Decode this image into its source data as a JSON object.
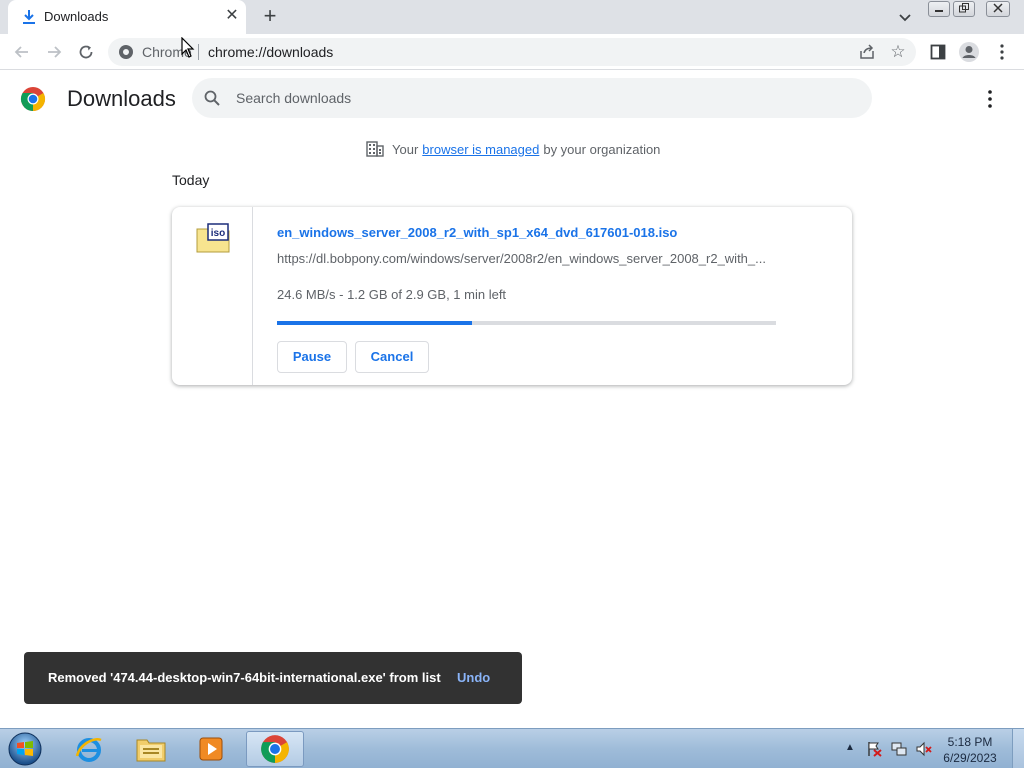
{
  "browser": {
    "tab": {
      "title": "Downloads",
      "icon": "download-icon",
      "close_icon": "close-icon"
    },
    "new_tab_icon": "plus-icon",
    "tab_search_icon": "chevron-down-icon",
    "window_controls": [
      "minimize",
      "restore",
      "close"
    ],
    "toolbar": {
      "back_icon": "back-arrow-icon",
      "forward_icon": "forward-arrow-icon",
      "reload_icon": "reload-icon",
      "omnibox": {
        "site_label": "Chrome",
        "url": "chrome://downloads"
      },
      "share_icon": "share-icon",
      "bookmark_icon": "star-icon",
      "side_panel_icon": "side-panel-icon",
      "profile_icon": "profile-icon",
      "menu_icon": "more-vert-icon"
    }
  },
  "page": {
    "title": "Downloads",
    "search": {
      "placeholder": "Search downloads",
      "value": ""
    },
    "managed_notice": {
      "prefix": "Your",
      "link": "browser is managed",
      "suffix": "by your organization"
    },
    "section_date": "Today"
  },
  "download": {
    "file_name": "en_windows_server_2008_r2_with_sp1_x64_dvd_617601-018.iso",
    "url": "https://dl.bobpony.com/windows/server/2008r2/en_windows_server_2008_r2_with_...",
    "status": "24.6 MB/s - 1.2 GB of 2.9 GB, 1 min left",
    "progress_fraction": 0.39,
    "file_icon": "iso-file-icon",
    "pause_label": "Pause",
    "cancel_label": "Cancel"
  },
  "toast": {
    "message": "Removed '474.44-desktop-win7-64bit-international.exe' from list",
    "undo_label": "Undo"
  },
  "taskbar": {
    "items": [
      "internet-explorer-icon",
      "file-explorer-icon",
      "media-player-icon",
      "chrome-icon"
    ],
    "active_item": "chrome-icon",
    "tray_icons": [
      "action-center-flag-icon",
      "network-icon",
      "volume-muted-icon"
    ],
    "clock": {
      "time": "5:18 PM",
      "date": "6/29/2023"
    }
  },
  "colors": {
    "accent": "#1a73e8",
    "tabstrip_bg": "#dee1e6",
    "toast_bg": "#323232",
    "taskbar_bg": "#9fbcd9"
  }
}
